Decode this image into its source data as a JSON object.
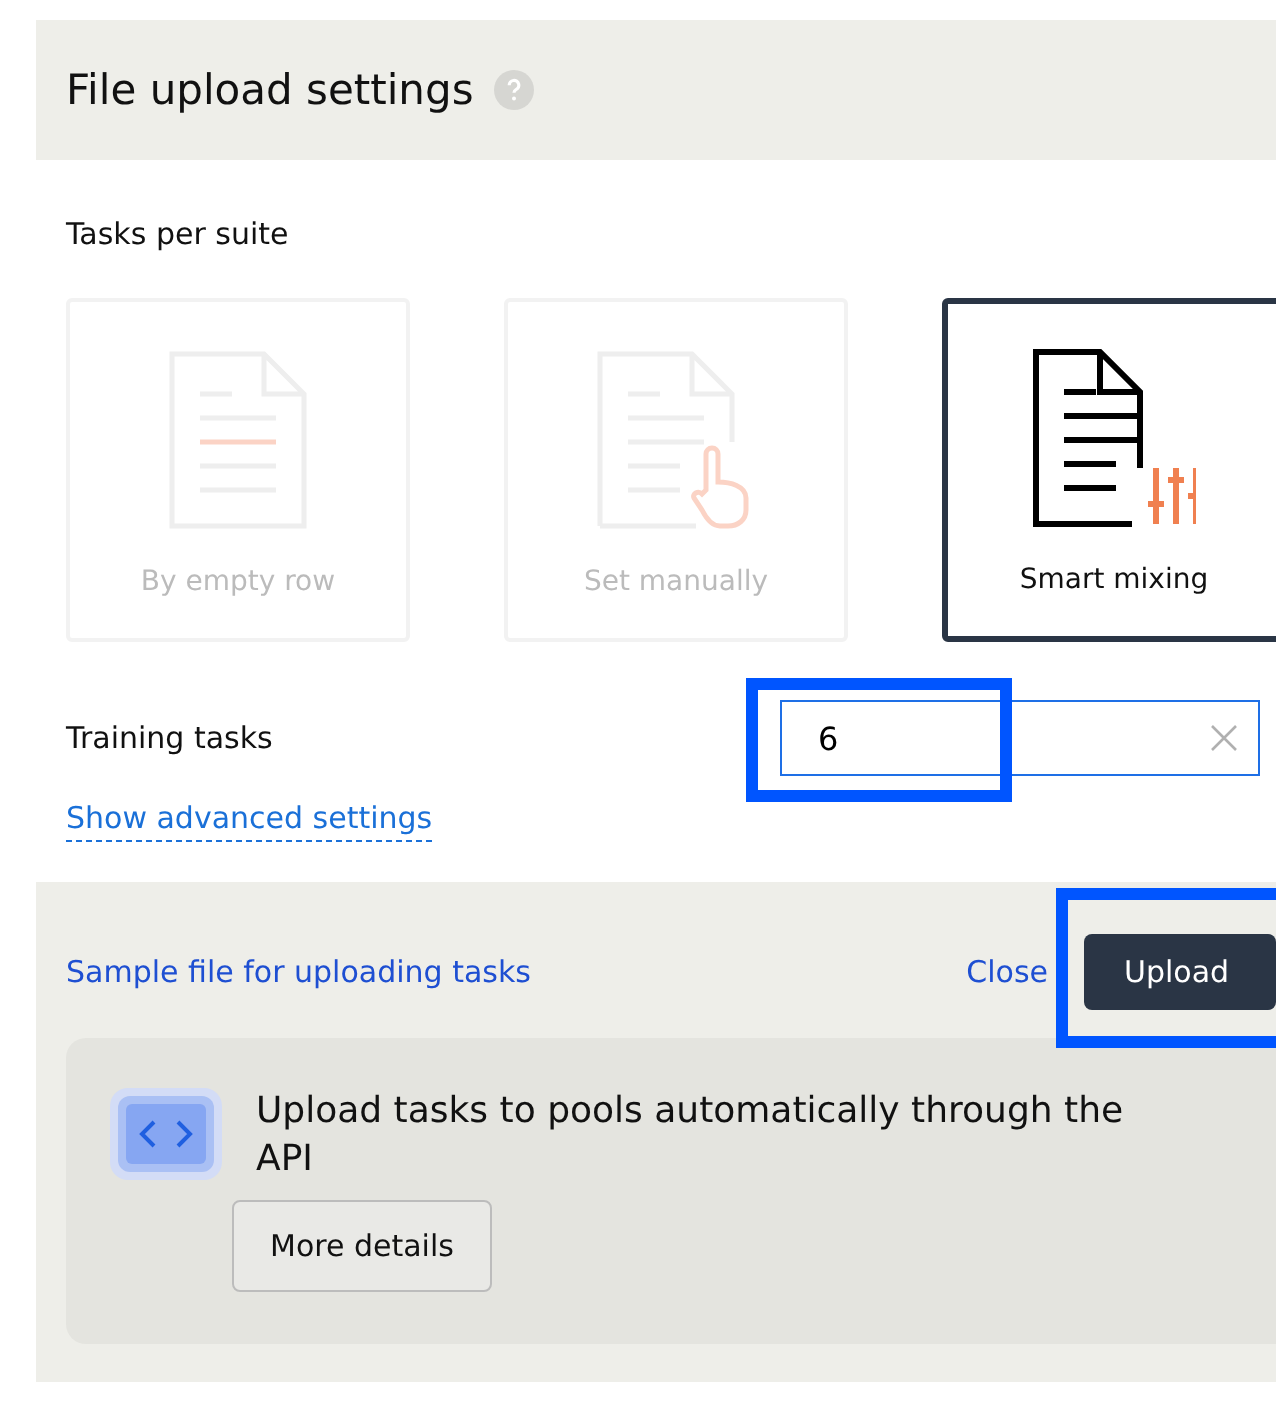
{
  "dialog": {
    "title": "File upload settings",
    "help_icon": true
  },
  "tasks_per_suite": {
    "label": "Tasks per suite",
    "options": [
      {
        "kind": "empty-row",
        "label": "By empty row",
        "selected": false
      },
      {
        "kind": "manual",
        "label": "Set manually",
        "selected": false
      },
      {
        "kind": "smart",
        "label": "Smart mixing",
        "selected": true
      }
    ]
  },
  "training_tasks": {
    "label": "Training tasks",
    "value": "6",
    "highlighted": true
  },
  "advanced_link": "Show advanced settings",
  "footer": {
    "sample_link": "Sample file for uploading tasks",
    "close": "Close",
    "upload": "Upload",
    "upload_highlighted": true
  },
  "api_promo": {
    "text": "Upload tasks to pools automatically through the API",
    "button": "More details"
  }
}
